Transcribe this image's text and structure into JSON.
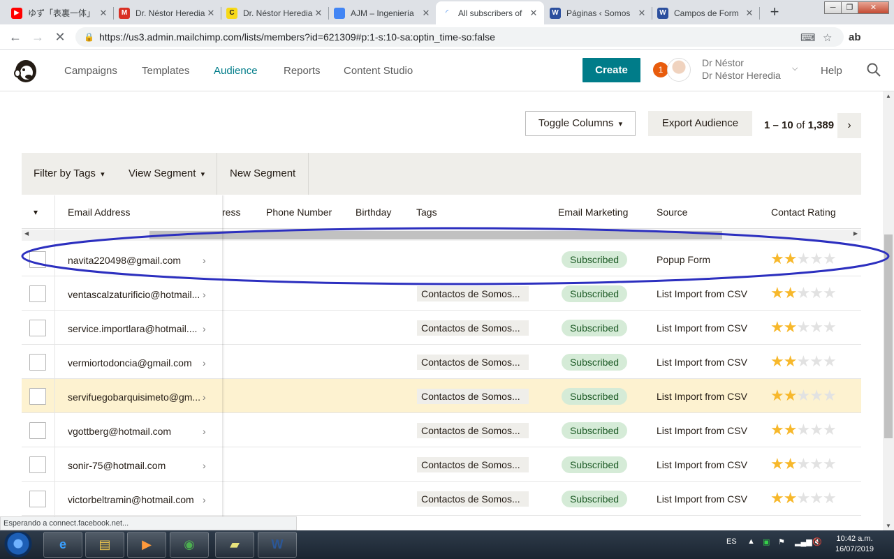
{
  "browser": {
    "tabs": [
      {
        "title": "ゆず「表裏一体」",
        "favicon": "youtube-icon",
        "color": "#ff0000",
        "glyph": "▶"
      },
      {
        "title": "Dr. Néstor Heredia",
        "favicon": "gmail-icon",
        "color": "#d93025",
        "glyph": "M"
      },
      {
        "title": "Dr. Néstor Heredia",
        "favicon": "mailchimp-icon",
        "color": "#f7d917",
        "glyph": "C"
      },
      {
        "title": "AJM – Ingeniería",
        "favicon": "chrome-icon",
        "color": "#4285f4",
        "glyph": "◉"
      },
      {
        "title": "All subscribers of",
        "favicon": "loading-icon",
        "color": "#1a73e8",
        "glyph": "◜"
      },
      {
        "title": "Páginas ‹ Somos",
        "favicon": "wordpress-icon",
        "color": "#2c4f9e",
        "glyph": "W"
      },
      {
        "title": "Campos de Form",
        "favicon": "wordpress-icon",
        "color": "#2c4f9e",
        "glyph": "W"
      }
    ],
    "url": "https://us3.admin.mailchimp.com/lists/members?id=621309#p:1-s:10-sa:optin_time-so:false",
    "status": "Esperando a connect.facebook.net..."
  },
  "header": {
    "nav": [
      "Campaigns",
      "Templates",
      "Audience",
      "Reports",
      "Content Studio"
    ],
    "active_nav": "Audience",
    "create_label": "Create",
    "notifications": "1",
    "user_line1": "Dr Néstor",
    "user_line2": "Dr Néstor Heredia",
    "help": "Help"
  },
  "toolbar": {
    "toggle_columns": "Toggle Columns",
    "export": "Export Audience",
    "pager_range": "1 – 10",
    "pager_of": "of",
    "pager_total": "1,389"
  },
  "filters": {
    "filter_by_tags": "Filter by Tags",
    "view_segment": "View Segment",
    "new_segment": "New Segment"
  },
  "table": {
    "columns": [
      "Email Address",
      "ress",
      "Phone Number",
      "Birthday",
      "Tags",
      "Email Marketing",
      "Source",
      "Contact Rating"
    ],
    "rows": [
      {
        "email": "navita220498@gmail.com",
        "tag": "",
        "status": "Subscribed",
        "source": "Popup Form",
        "rating": 2
      },
      {
        "email": "ventascalzaturificio@hotmail...",
        "tag": "Contactos de Somos...",
        "status": "Subscribed",
        "source": "List Import from CSV",
        "rating": 2
      },
      {
        "email": "service.importlara@hotmail....",
        "tag": "Contactos de Somos...",
        "status": "Subscribed",
        "source": "List Import from CSV",
        "rating": 2
      },
      {
        "email": "vermiortodoncia@gmail.com",
        "tag": "Contactos de Somos...",
        "status": "Subscribed",
        "source": "List Import from CSV",
        "rating": 2
      },
      {
        "email": "servifuegobarquisimeto@gm...",
        "tag": "Contactos de Somos...",
        "status": "Subscribed",
        "source": "List Import from CSV",
        "rating": 2
      },
      {
        "email": "vgottberg@hotmail.com",
        "tag": "Contactos de Somos...",
        "status": "Subscribed",
        "source": "List Import from CSV",
        "rating": 2
      },
      {
        "email": "sonir-75@hotmail.com",
        "tag": "Contactos de Somos...",
        "status": "Subscribed",
        "source": "List Import from CSV",
        "rating": 2
      },
      {
        "email": "victorbeltramin@hotmail.com",
        "tag": "Contactos de Somos...",
        "status": "Subscribed",
        "source": "List Import from CSV",
        "rating": 2
      }
    ],
    "highlighted_row": 4
  },
  "taskbar": {
    "apps": [
      {
        "name": "internet-explorer-icon",
        "glyph": "e",
        "color": "#3aa0ff"
      },
      {
        "name": "file-explorer-icon",
        "glyph": "▤",
        "color": "#f2c94c"
      },
      {
        "name": "media-player-icon",
        "glyph": "▶",
        "color": "#ff9a3c"
      },
      {
        "name": "chrome-icon",
        "glyph": "◉",
        "color": "#4caf50"
      },
      {
        "name": "sticky-notes-icon",
        "glyph": "▰",
        "color": "#e8e37c"
      },
      {
        "name": "word-icon",
        "glyph": "W",
        "color": "#2b5797"
      }
    ],
    "language": "ES",
    "time": "10:42 a.m.",
    "date": "16/07/2019"
  },
  "colors": {
    "accent": "#007c89",
    "annotation": "#2c2fbf",
    "star": "#f7b82b",
    "subscribed_bg": "#d5ebd7",
    "highlight_row": "#fdf2d0"
  }
}
